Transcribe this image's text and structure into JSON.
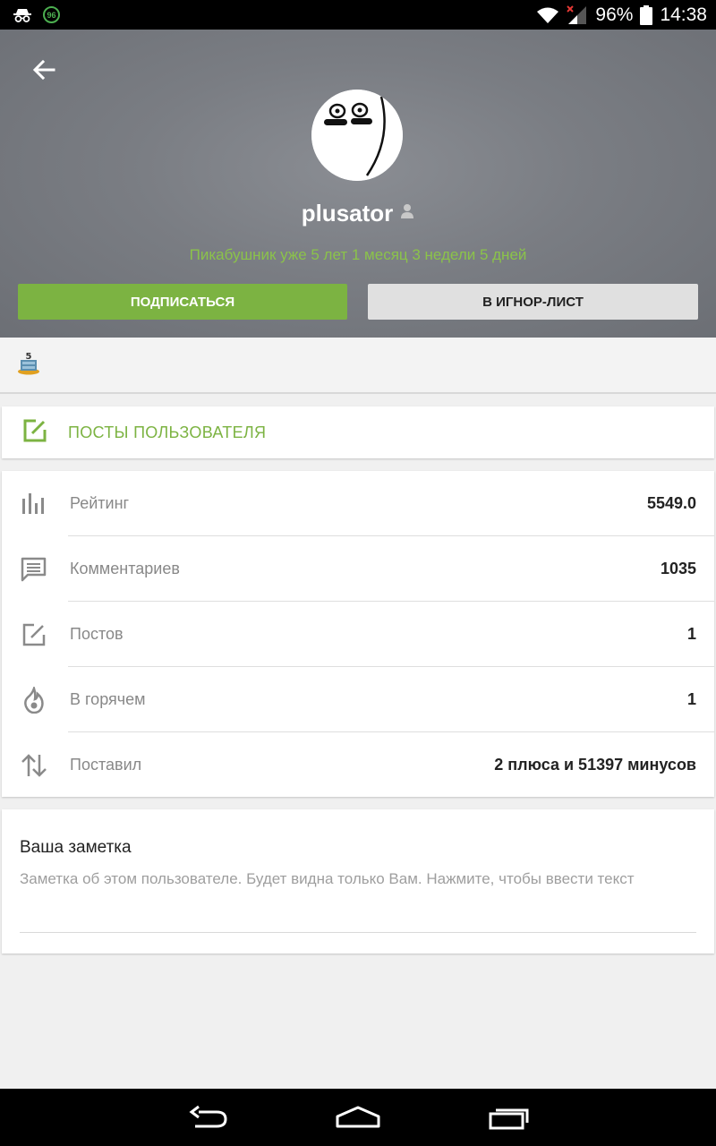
{
  "status_bar": {
    "battery": "96%",
    "time": "14:38",
    "notification_badge": "96"
  },
  "header": {
    "username": "plusator",
    "tenure": "Пикабушник уже 5 лет 1 месяц 3 недели 5 дней",
    "subscribe_label": "ПОДПИСАТЬСЯ",
    "ignore_label": "В ИГНОР-ЛИСТ"
  },
  "awards": {
    "badge_number": "5"
  },
  "posts_link": {
    "label": "ПОСТЫ ПОЛЬЗОВАТЕЛЯ"
  },
  "stats": [
    {
      "label": "Рейтинг",
      "value": "5549.0",
      "icon": "bar-chart-icon"
    },
    {
      "label": "Комментариев",
      "value": "1035",
      "icon": "comment-icon"
    },
    {
      "label": "Постов",
      "value": "1",
      "icon": "edit-icon"
    },
    {
      "label": "В горячем",
      "value": "1",
      "icon": "fire-icon"
    },
    {
      "label": "Поставил",
      "value": "2 плюса и 51397 минусов",
      "icon": "swap-vertical-icon"
    }
  ],
  "note": {
    "title": "Ваша заметка",
    "placeholder": "Заметка об этом пользователе. Будет видна только Вам. Нажмите, чтобы ввести текст"
  },
  "colors": {
    "accent": "#7cb342",
    "tenure": "#8bc34a",
    "header_bg": "#7a7d83"
  }
}
